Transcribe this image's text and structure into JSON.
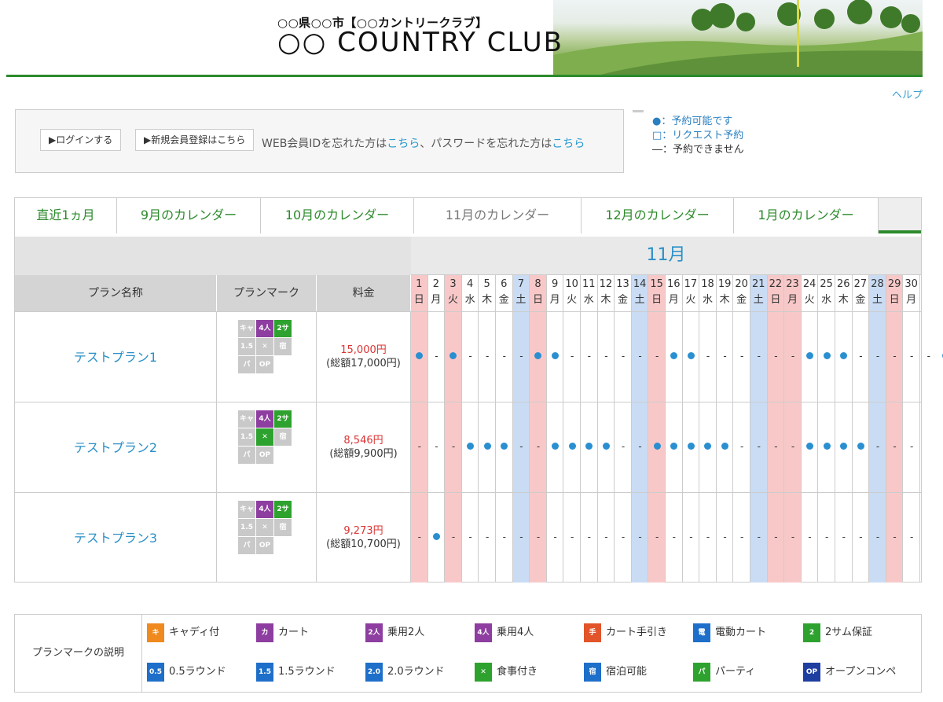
{
  "header": {
    "subtitle": "○○県○○市【○○カントリークラブ】",
    "title": "○○ COUNTRY CLUB"
  },
  "help_label": "ヘルプ",
  "login": {
    "login_button": "▶ログインする",
    "register_button": "▶新規会員登録はこちら",
    "forgot_prefix": "WEB会員IDを忘れた方は",
    "forgot_link1": "こちら",
    "forgot_mid": "、パスワードを忘れた方は",
    "forgot_link2": "こちら"
  },
  "legend": {
    "available": "●：予約可能です",
    "request": "□：リクエスト予約",
    "unavailable": "―：予約できません"
  },
  "tabs": [
    "直近1ヵ月",
    "9月のカレンダー",
    "10月のカレンダー",
    "11月のカレンダー",
    "12月のカレンダー",
    "1月のカレンダー"
  ],
  "active_tab": 3,
  "month_label": "11月",
  "columns": {
    "plan_name": "プラン名称",
    "plan_mark": "プランマーク",
    "price": "料金"
  },
  "days": [
    {
      "d": "1",
      "w": "日",
      "t": "sun"
    },
    {
      "d": "2",
      "w": "月",
      "t": ""
    },
    {
      "d": "3",
      "w": "火",
      "t": "hol"
    },
    {
      "d": "4",
      "w": "水",
      "t": ""
    },
    {
      "d": "5",
      "w": "木",
      "t": ""
    },
    {
      "d": "6",
      "w": "金",
      "t": ""
    },
    {
      "d": "7",
      "w": "土",
      "t": "sat"
    },
    {
      "d": "8",
      "w": "日",
      "t": "sun"
    },
    {
      "d": "9",
      "w": "月",
      "t": ""
    },
    {
      "d": "10",
      "w": "火",
      "t": ""
    },
    {
      "d": "11",
      "w": "水",
      "t": ""
    },
    {
      "d": "12",
      "w": "木",
      "t": ""
    },
    {
      "d": "13",
      "w": "金",
      "t": ""
    },
    {
      "d": "14",
      "w": "土",
      "t": "sat"
    },
    {
      "d": "15",
      "w": "日",
      "t": "sun"
    },
    {
      "d": "16",
      "w": "月",
      "t": ""
    },
    {
      "d": "17",
      "w": "火",
      "t": ""
    },
    {
      "d": "18",
      "w": "水",
      "t": ""
    },
    {
      "d": "19",
      "w": "木",
      "t": ""
    },
    {
      "d": "20",
      "w": "金",
      "t": ""
    },
    {
      "d": "21",
      "w": "土",
      "t": "sat"
    },
    {
      "d": "22",
      "w": "日",
      "t": "sun"
    },
    {
      "d": "23",
      "w": "月",
      "t": "hol"
    },
    {
      "d": "24",
      "w": "火",
      "t": ""
    },
    {
      "d": "25",
      "w": "水",
      "t": ""
    },
    {
      "d": "26",
      "w": "木",
      "t": ""
    },
    {
      "d": "27",
      "w": "金",
      "t": ""
    },
    {
      "d": "28",
      "w": "土",
      "t": "sat"
    },
    {
      "d": "29",
      "w": "日",
      "t": "sun"
    },
    {
      "d": "30",
      "w": "月",
      "t": ""
    }
  ],
  "plans": [
    {
      "name": "テストプラン1",
      "price": "15,000円",
      "total": "(総額17,000円)",
      "avail": "●-●----●●------●●------●●●-----●●-"
    },
    {
      "name": "テストプラン2",
      "price": "8,546円",
      "total": "(総額9,900円)",
      "avail": "---●●●--●●●●--●●●●●----●●●●---"
    },
    {
      "name": "テストプラン3",
      "price": "9,273円",
      "total": "(総額10,700円)",
      "avail": "-●----------------------------"
    }
  ],
  "mark_legend": {
    "label": "プランマークの説明",
    "items": [
      {
        "icon": "caddie-icon",
        "text": "キャディ付"
      },
      {
        "icon": "cart-icon",
        "text": "カート"
      },
      {
        "icon": "cart-2-person-icon",
        "text": "乗用2人"
      },
      {
        "icon": "cart-4-person-icon",
        "text": "乗用4人"
      },
      {
        "icon": "hand-cart-icon",
        "text": "カート手引き"
      },
      {
        "icon": "electric-cart-icon",
        "text": "電動カート"
      },
      {
        "icon": "two-some-icon",
        "text": "2サム保証"
      },
      {
        "icon": "half-round-icon",
        "text": "0.5ラウンド"
      },
      {
        "icon": "one-half-round-icon",
        "text": "1.5ラウンド"
      },
      {
        "icon": "two-round-icon",
        "text": "2.0ラウンド"
      },
      {
        "icon": "meal-icon",
        "text": "食事付き"
      },
      {
        "icon": "lodging-icon",
        "text": "宿泊可能"
      },
      {
        "icon": "party-icon",
        "text": "パーティ"
      },
      {
        "icon": "open-compe-icon",
        "text": "オープンコンペ"
      }
    ]
  }
}
